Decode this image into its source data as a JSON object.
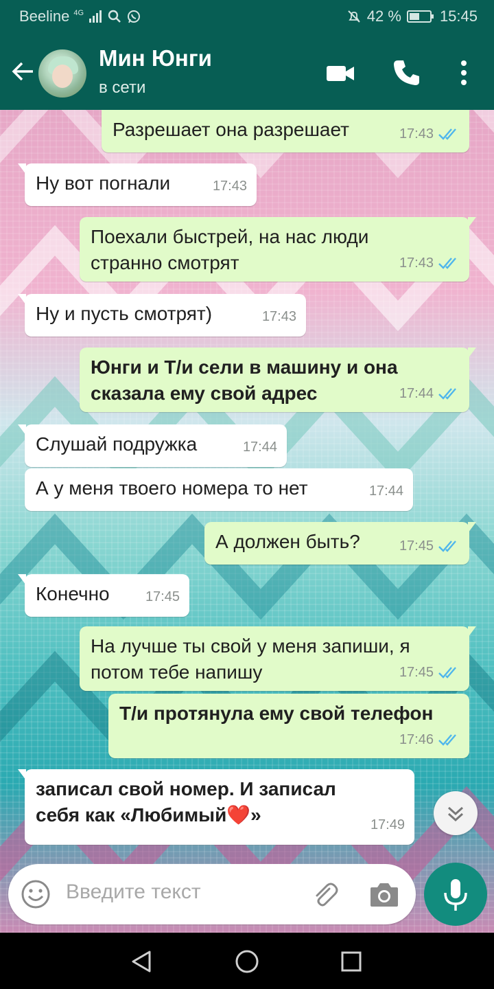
{
  "status_bar": {
    "carrier": "Beeline",
    "network": "4G",
    "battery": "42 %",
    "time": "15:45"
  },
  "header": {
    "name": "Мин Юнги",
    "status": "в сети"
  },
  "messages": [
    {
      "dir": "out",
      "text": "Разрешает она разрешает",
      "time": "17:43",
      "bold": false
    },
    {
      "dir": "in",
      "text": "Ну вот погнали",
      "time": "17:43",
      "bold": false
    },
    {
      "dir": "out",
      "text": "Поехали быстрей, на нас люди странно смотрят",
      "time": "17:43",
      "bold": false
    },
    {
      "dir": "in",
      "text": "Ну и пусть смотрят)",
      "time": "17:43",
      "bold": false
    },
    {
      "dir": "out",
      "text": "Юнги и Т/и сели в машину и она сказала ему свой адрес",
      "time": "17:44",
      "bold": true
    },
    {
      "dir": "in",
      "text": "Слушай подружка",
      "time": "17:44",
      "bold": false
    },
    {
      "dir": "in",
      "text": "А у меня твоего номера то нет",
      "time": "17:44",
      "bold": false
    },
    {
      "dir": "out",
      "text": "А должен быть?",
      "time": "17:45",
      "bold": false
    },
    {
      "dir": "in",
      "text": "Конечно",
      "time": "17:45",
      "bold": false
    },
    {
      "dir": "out",
      "text": "На лучше ты свой у меня запиши, я потом тебе напишу",
      "time": "17:45",
      "bold": false
    },
    {
      "dir": "out",
      "text": "Т/и протянула ему свой телефон",
      "time": "17:46",
      "bold": true
    },
    {
      "dir": "in",
      "text": "записал свой номер. И записал себя как «Любимый❤️»",
      "time": "17:49",
      "bold": true
    }
  ],
  "input": {
    "placeholder": "Введите текст"
  },
  "colors": {
    "header": "#075e54",
    "outgoing": "#e1fbc9",
    "incoming": "#ffffff",
    "ticks": "#4fb6ec",
    "accent": "#128c7e"
  },
  "icons": [
    "back-arrow-icon",
    "video-call-icon",
    "phone-icon",
    "more-vert-icon",
    "emoji-icon",
    "attach-icon",
    "camera-icon",
    "mic-icon",
    "chevrons-down-icon",
    "nav-back-icon",
    "nav-home-icon",
    "nav-recents-icon"
  ]
}
